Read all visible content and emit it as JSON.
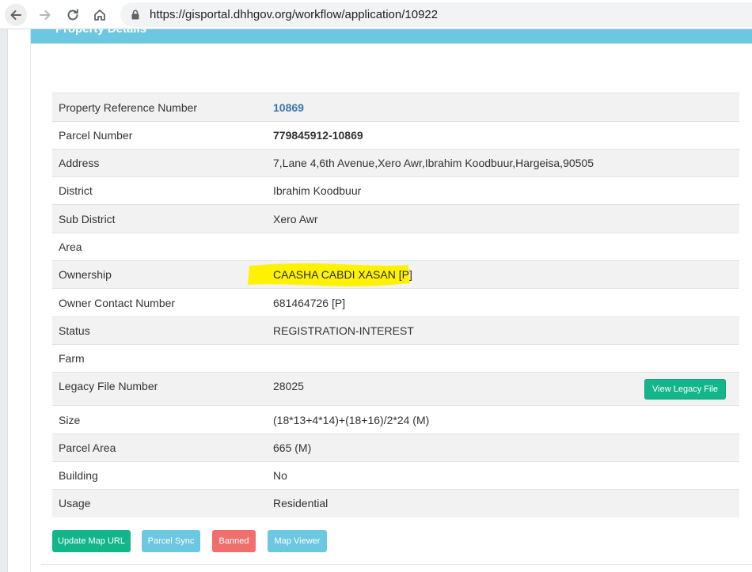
{
  "browser": {
    "url": "https://gisportal.dhhgov.org/workflow/application/10922",
    "back_icon": "arrow-left-icon",
    "forward_icon": "arrow-right-icon",
    "reload_icon": "reload-icon",
    "home_icon": "home-icon",
    "lock_icon": "lock-icon"
  },
  "panel": {
    "title": "Property Details",
    "header_color": "#6cc7e0"
  },
  "details": {
    "rows": [
      {
        "label": "Property Reference Number",
        "value": "10869"
      },
      {
        "label": "Parcel Number",
        "value": "779845912-10869"
      },
      {
        "label": "Address",
        "value": "7,Lane 4,6th Avenue,Xero Awr,Ibrahim Koodbuur,Hargeisa,90505"
      },
      {
        "label": "District",
        "value": "Ibrahim Koodbuur"
      },
      {
        "label": "Sub District",
        "value": "Xero Awr"
      },
      {
        "label": "Area",
        "value": ""
      },
      {
        "label": "Ownership",
        "value": "CAASHA CABDI XASAN [P]"
      },
      {
        "label": "Owner Contact Number",
        "value": "681464726 [P]"
      },
      {
        "label": "Status",
        "value": "REGISTRATION-INTEREST"
      },
      {
        "label": "Farm",
        "value": ""
      },
      {
        "label": "Legacy File Number",
        "value": "28025",
        "action_label": "View Legacy File"
      },
      {
        "label": "Size",
        "value": "(18*13+4*14)+(18+16)/2*24 (M)"
      },
      {
        "label": "Parcel Area",
        "value": "665 (M)"
      },
      {
        "label": "Building",
        "value": "No"
      },
      {
        "label": "Usage",
        "value": "Residential"
      }
    ]
  },
  "actions": {
    "update_map_url": "Update Map URL",
    "parcel_sync": "Parcel Sync",
    "banned": "Banned",
    "map_viewer": "Map Viewer"
  },
  "colors": {
    "link": "#3a76b3",
    "success": "#13b68a",
    "info": "#6cc7e0",
    "danger": "#ef6f6c",
    "highlight": "#fff200"
  }
}
